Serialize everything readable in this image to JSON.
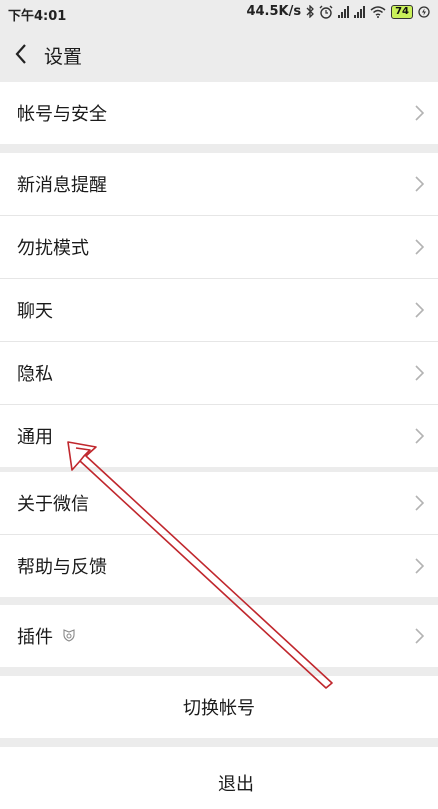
{
  "status_bar": {
    "time": "下午4:01",
    "net_speed": "44.5K/s",
    "battery": "74"
  },
  "nav": {
    "title": "设置"
  },
  "groups": {
    "account": {
      "items": [
        "帐号与安全"
      ]
    },
    "main": {
      "items": [
        "新消息提醒",
        "勿扰模式",
        "聊天",
        "隐私",
        "通用"
      ]
    },
    "about": {
      "items": [
        "关于微信",
        "帮助与反馈"
      ]
    },
    "plugins": {
      "items": [
        "插件"
      ]
    },
    "switch_account": {
      "label": "切换帐号"
    },
    "logout": {
      "label": "退出"
    }
  },
  "colors": {
    "background": "#ececec",
    "annotation_arrow": "#c0272d"
  }
}
